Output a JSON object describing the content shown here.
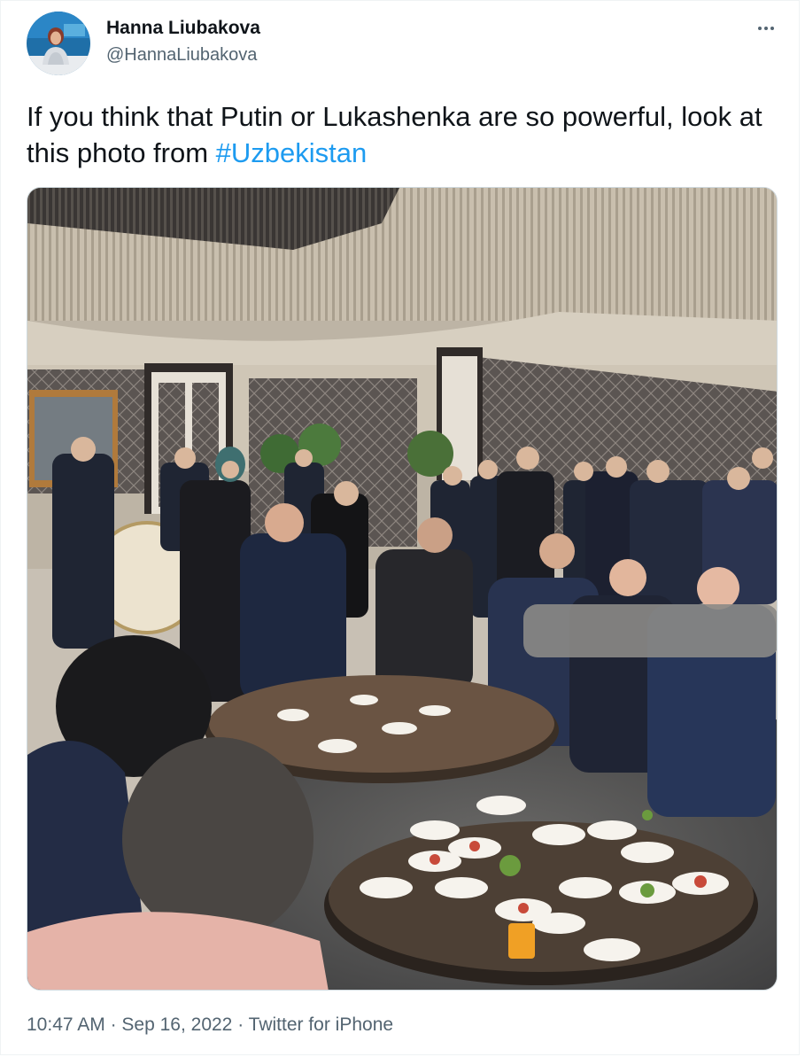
{
  "tweet": {
    "author_name": "Hanna Liubakova",
    "author_handle": "@HannaLiubakova",
    "text_before": "If you think that Putin or Lukashenka are so powerful, look at this photo from ",
    "hashtag": "#Uzbekistan",
    "time": "10:47 AM",
    "separator_1": " · ",
    "date": "Sep 16, 2022",
    "separator_2": " · ",
    "source": "Twitter for iPhone"
  },
  "icons": {
    "more": "more-horizontal-icon"
  },
  "colors": {
    "link": "#1d9bf0",
    "secondary_text": "#536471",
    "primary_text": "#0f1419"
  }
}
